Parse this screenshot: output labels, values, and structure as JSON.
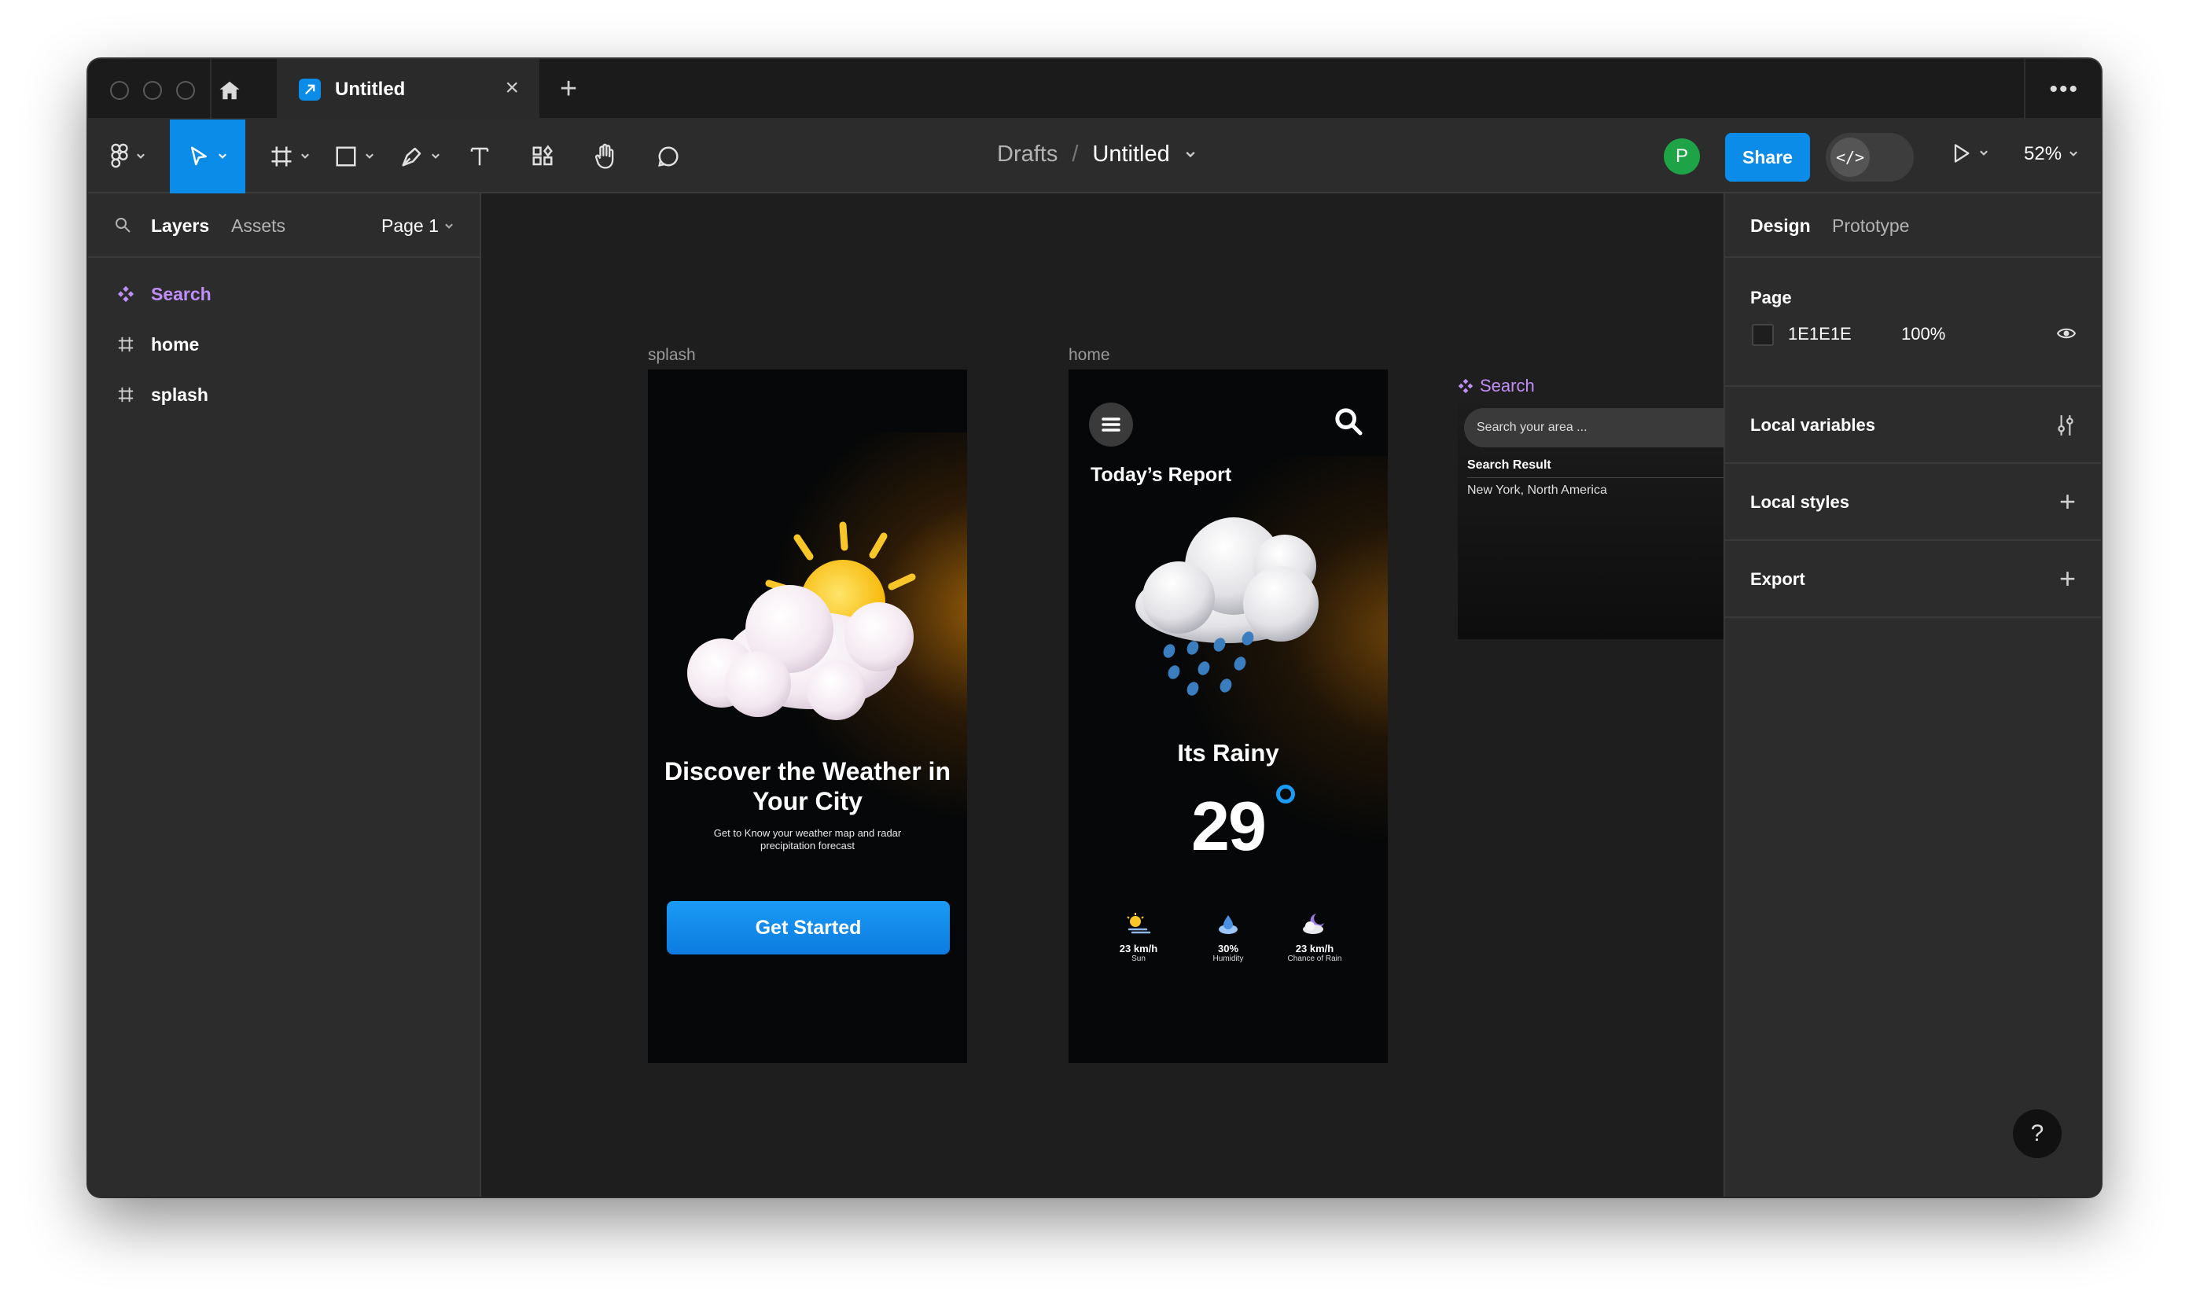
{
  "window": {
    "tab_title": "Untitled",
    "new_tab": "+",
    "more": "•••"
  },
  "toolbar": {
    "breadcrumb_parent": "Drafts",
    "breadcrumb_sep": "/",
    "file_title": "Untitled",
    "avatar_initial": "P",
    "share_label": "Share",
    "zoom": "52%"
  },
  "left_panel": {
    "tab_layers": "Layers",
    "tab_assets": "Assets",
    "page_selector": "Page 1",
    "layers": [
      {
        "label": "Search",
        "type": "component"
      },
      {
        "label": "home",
        "type": "frame"
      },
      {
        "label": "splash",
        "type": "frame"
      }
    ]
  },
  "right_panel": {
    "tab_design": "Design",
    "tab_prototype": "Prototype",
    "page_heading": "Page",
    "page_color": "1E1E1E",
    "page_opacity": "100%",
    "local_variables": "Local variables",
    "local_styles": "Local styles",
    "export": "Export",
    "help": "?"
  },
  "canvas": {
    "splash": {
      "frame_label": "splash",
      "title": "Discover the Weather in Your City",
      "subtitle": "Get to Know your weather map and radar precipitation forecast",
      "cta": "Get Started"
    },
    "home": {
      "frame_label": "home",
      "heading": "Today’s Report",
      "condition": "Its Rainy",
      "temperature": "29",
      "stats": [
        {
          "value": "23 km/h",
          "label": "Sun"
        },
        {
          "value": "30%",
          "label": "Humidity"
        },
        {
          "value": "23 km/h",
          "label": "Chance of Rain"
        }
      ]
    },
    "search_component": {
      "label": "Search",
      "placeholder": "Search your area ...",
      "result_heading": "Search Result",
      "result_item": "New York, North America"
    }
  },
  "colors": {
    "accent": "#0c8ce9",
    "component": "#c08ef7",
    "canvas_bg": "#1e1e1e",
    "panel_bg": "#2c2c2c",
    "avatar": "#1ea446"
  }
}
